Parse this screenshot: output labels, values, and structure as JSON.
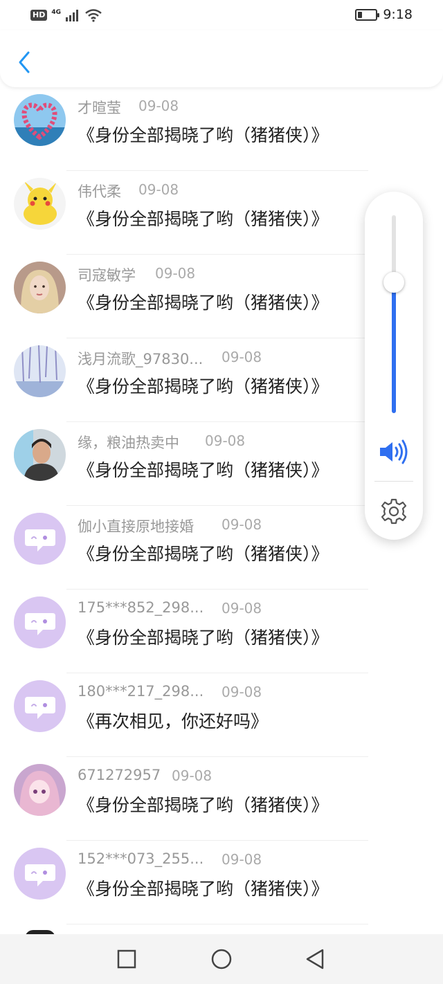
{
  "status_bar": {
    "network": "4G",
    "badge": "HD",
    "time": "9:18",
    "battery_level": 0.25
  },
  "header": {
    "back_icon": "chevron-left-icon"
  },
  "colors": {
    "accent": "#2f6ff0",
    "back": "#2196f3",
    "default_avatar": "#d9c6f2"
  },
  "messages": [
    {
      "name": "才暄莹",
      "date": "09-08",
      "text": "《身份全部揭晓了哟（猪猪侠）》",
      "avatar": "heart-flowers-avatar"
    },
    {
      "name": "伟代柔",
      "date": "09-08",
      "text": "《身份全部揭晓了哟（猪猪侠）》",
      "avatar": "pikachu-avatar"
    },
    {
      "name": "司寇敏学",
      "date": "09-08",
      "text": "《身份全部揭晓了哟（猪猪侠）》",
      "avatar": "portrait-avatar"
    },
    {
      "name": "浅月流歌_97830...",
      "date": "09-08",
      "text": "《身份全部揭晓了哟（猪猪侠）》",
      "avatar": "blossom-tree-avatar"
    },
    {
      "name": "缘，粮油热卖中",
      "date": "09-08",
      "text": "《身份全部揭晓了哟（猪猪侠）》",
      "avatar": "photo-avatar"
    },
    {
      "name": "伽小直接原地接婚",
      "date": "09-08",
      "text": "《身份全部揭晓了哟（猪猪侠）》",
      "avatar": "default-chat-avatar"
    },
    {
      "name": "175***852_298...",
      "date": "09-08",
      "text": "《身份全部揭晓了哟（猪猪侠）》",
      "avatar": "default-chat-avatar"
    },
    {
      "name": "180***217_298...",
      "date": "09-08",
      "text": "《再次相见，你还好吗》",
      "avatar": "default-chat-avatar"
    },
    {
      "name": "671272957",
      "date": "09-08",
      "text": "《身份全部揭晓了哟（猪猪侠）》",
      "avatar": "anime-girl-avatar"
    },
    {
      "name": "152***073_255...",
      "date": "09-08",
      "text": "《身份全部揭晓了哟（猪猪侠）》",
      "avatar": "default-chat-avatar"
    }
  ],
  "volume": {
    "level": 0.66,
    "icon": "speaker-icon",
    "settings_icon": "gear-icon"
  },
  "nav_bar": {
    "buttons": [
      "recent-apps-button",
      "home-button",
      "back-button"
    ]
  }
}
